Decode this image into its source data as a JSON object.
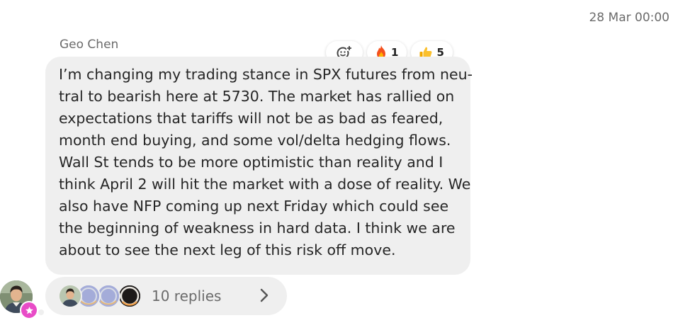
{
  "timestamp": "28 Mar 00:00",
  "message": {
    "sender": "Geo Chen",
    "lines": [
      "I’m changing my trading stance in SPX futures from neu-",
      "tral to bearish here at 5730. The market has rallied on",
      "expectations that tariffs will not be as bad as feared,",
      "month end buying, and some vol/delta hedging flows.",
      "Wall St tends to be more optimistic than reality and I",
      "think April 2 will hit the market with a dose of reality. We",
      "also have NFP coming up next Friday which could see",
      "the beginning of weakness in hard data. I think we are",
      "about to see the next leg of this risk off move."
    ]
  },
  "reactions": [
    {
      "icon": "add-reaction-icon",
      "count": ""
    },
    {
      "icon": "fire-icon",
      "count": "1"
    },
    {
      "icon": "thumbs-up-icon",
      "count": "5"
    }
  ],
  "replies": {
    "label": "10 replies",
    "avatar_icons": [
      "person-avatar",
      "placeholder-avatar",
      "placeholder-avatar",
      "dark-avatar"
    ]
  },
  "colors": {
    "bubble": "#efefef",
    "badge": "#e84cc7",
    "muted_text": "#6b6b6b"
  }
}
